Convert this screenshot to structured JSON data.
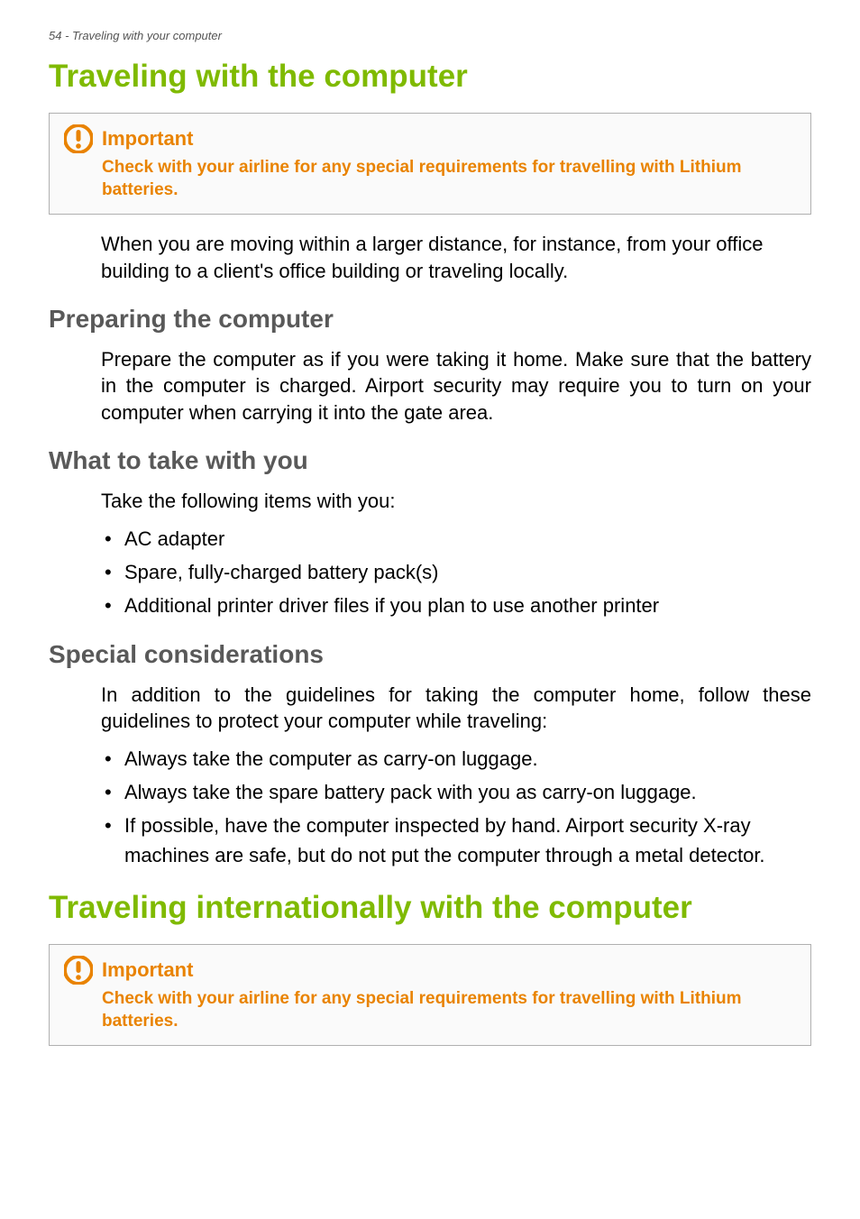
{
  "header": {
    "text": "54 - Traveling with your computer"
  },
  "h1_1": "Traveling with the computer",
  "callout1": {
    "title": "Important",
    "body": "Check with your airline for any special requirements for travelling with Lithium batteries."
  },
  "intro": "When you are moving within a larger distance, for instance, from your office building to a client's office building or traveling locally.",
  "h2_1": "Preparing the computer",
  "prep_body": "Prepare the computer as if you were taking it home. Make sure that the battery in the computer is charged. Airport security may require you to turn on your computer when carrying it into the gate area.",
  "h2_2": "What to take with you",
  "take_intro": "Take the following items with you:",
  "take_items": [
    "AC adapter",
    "Spare, fully-charged battery pack(s)",
    "Additional printer driver files if you plan to use another printer"
  ],
  "h2_3": "Special considerations",
  "special_intro": "In addition to the guidelines for taking the computer home, follow these guidelines to protect your computer while traveling:",
  "special_items": [
    "Always take the computer as carry-on luggage.",
    "Always take the spare battery pack with you as carry-on luggage.",
    "If possible, have the computer inspected by hand. Airport security X-ray machines are safe, but do not put the computer through a metal detector."
  ],
  "h1_2": "Traveling internationally with the computer",
  "callout2": {
    "title": "Important",
    "body": "Check with your airline for any special requirements for travelling with Lithium batteries."
  }
}
